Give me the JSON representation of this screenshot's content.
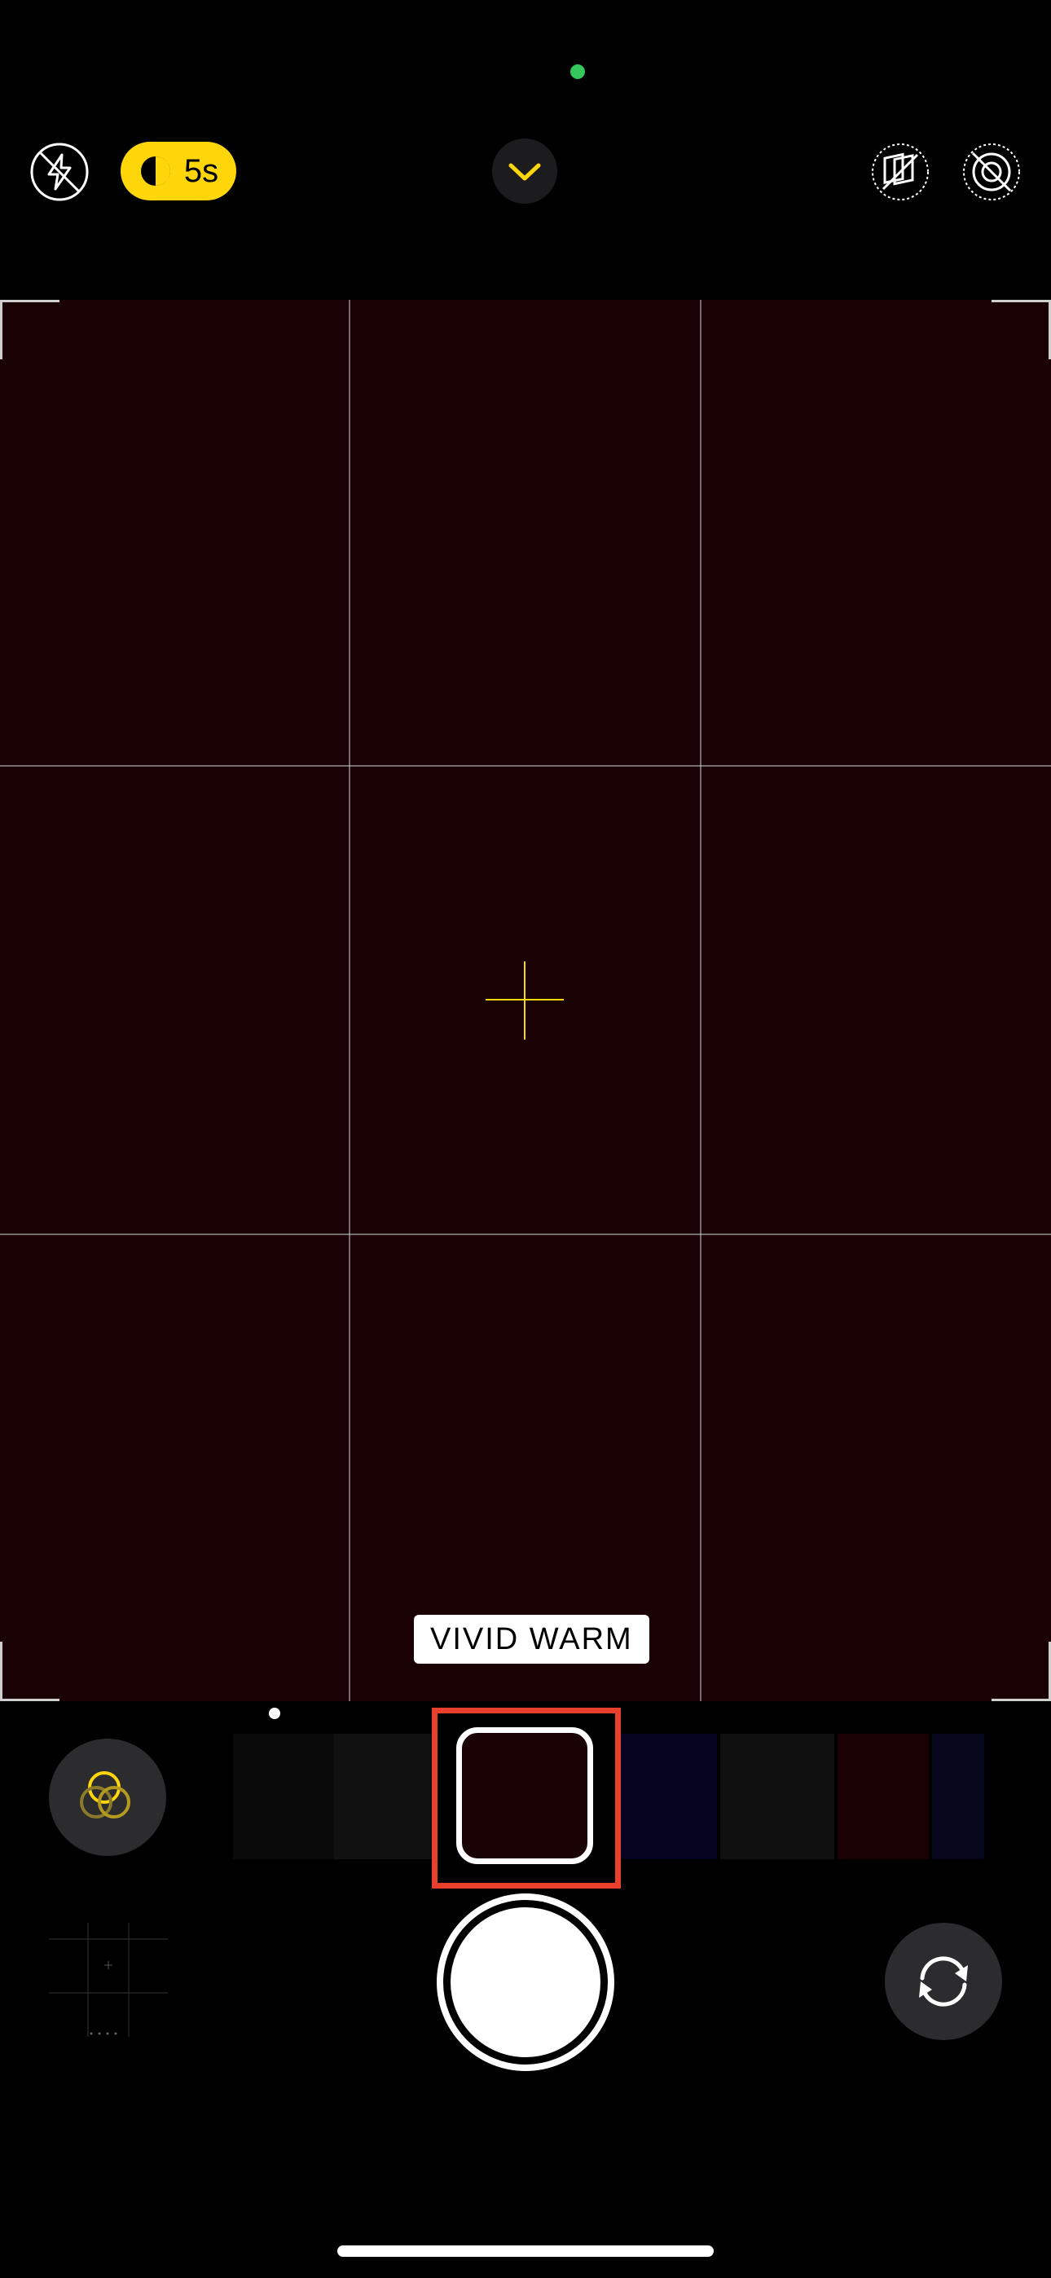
{
  "top_bar": {
    "flash": {
      "icon": "flash-off-icon"
    },
    "exposure": {
      "label": "5s",
      "icon": "night-mode-icon",
      "color": "#ffd60a"
    },
    "controls_toggle": {
      "icon": "chevron-down-icon"
    },
    "photographic_styles": {
      "icon": "photographic-styles-icon"
    },
    "live_photo": {
      "icon": "live-photo-off-icon"
    },
    "privacy_indicator_color": "#34c759"
  },
  "viewfinder": {
    "background": "#1a0204",
    "grid": true,
    "focus_color": "#ffd60a",
    "style_label": "VIVID WARM"
  },
  "style_strip": {
    "selected_style": "VIVID WARM",
    "swatches": [
      "#0a0a0a",
      "#111111",
      "#1a0204",
      "#050522",
      "#101010",
      "#1a0204",
      "#06061c"
    ],
    "selection_color": "#e8402c"
  },
  "bottom": {
    "styles_button_icon": "styles-icon",
    "shutter_icon": "shutter-icon",
    "flip_icon": "camera-flip-icon",
    "thumbnail_icon": "last-photo-thumbnail"
  }
}
